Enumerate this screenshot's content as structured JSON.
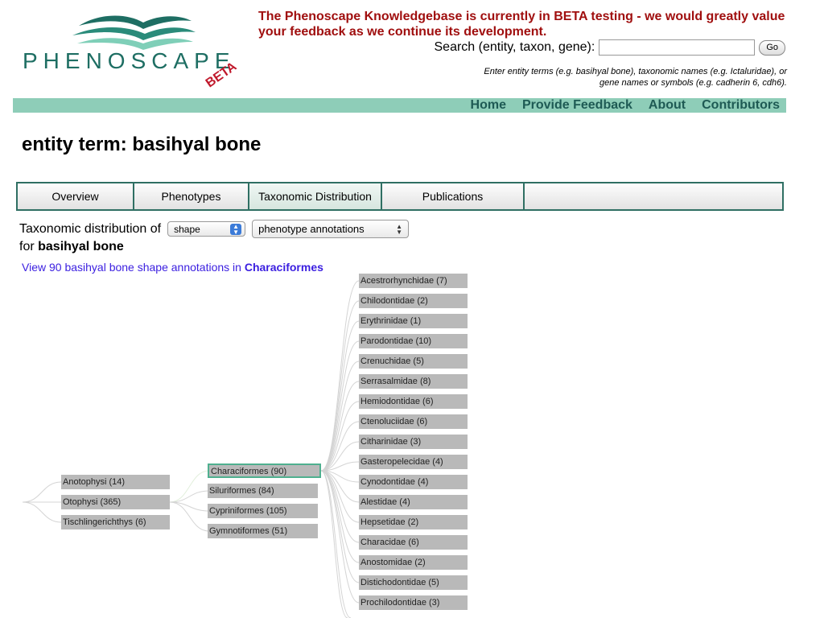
{
  "logo": {
    "word": "PHENOSCAPE",
    "badge": "BETA"
  },
  "header": {
    "beta_notice": "The Phenoscape Knowledgebase is currently in BETA testing - we would greatly value your feedback as we continue its development.",
    "search_label": "Search (entity, taxon, gene):",
    "search_value": "",
    "go_label": "Go",
    "search_help": "Enter entity terms (e.g. basihyal bone), taxonomic names (e.g. Ictaluridae), or gene names or symbols (e.g. cadherin 6, cdh6)."
  },
  "nav": {
    "home": "Home",
    "feedback": "Provide Feedback",
    "about": "About",
    "contributors": "Contributors"
  },
  "page": {
    "title": "entity term: basihyal bone"
  },
  "tabs": [
    "Overview",
    "Phenotypes",
    "Taxonomic Distribution",
    "Publications"
  ],
  "controls": {
    "prefix": "Taxonomic distribution of",
    "select1": "shape",
    "select2": "phenotype annotations",
    "for_label": "for",
    "entity": "basihyal bone"
  },
  "view_link": {
    "text": "View 90 basihyal bone shape annotations in",
    "taxon": "Characiformes"
  },
  "tree": {
    "level1": [
      "Anotophysi (14)",
      "Otophysi (365)",
      "Tischlingerichthys (6)"
    ],
    "level2": [
      "Characiformes (90)",
      "Siluriformes (84)",
      "Cypriniformes (105)",
      "Gymnotiformes (51)"
    ],
    "level3": [
      "Acestrorhynchidae (7)",
      "Chilodontidae (2)",
      "Erythrinidae (1)",
      "Parodontidae (10)",
      "Crenuchidae (5)",
      "Serrasalmidae (8)",
      "Hemiodontidae (6)",
      "Ctenoluciidae (6)",
      "Citharinidae (3)",
      "Gasteropelecidae (4)",
      "Cynodontidae (4)",
      "Alestidae (4)",
      "Hepsetidae (2)",
      "Characidae (6)",
      "Anostomidae (2)",
      "Distichodontidae (5)",
      "Prochilodontidae (3)"
    ]
  },
  "colors": {
    "brand_teal": "#1e6e63",
    "notice_red": "#a00f0f",
    "nav_bg": "#8ecdb8",
    "node_bg": "#b9b9b9",
    "selected_border": "#4fb08f"
  }
}
